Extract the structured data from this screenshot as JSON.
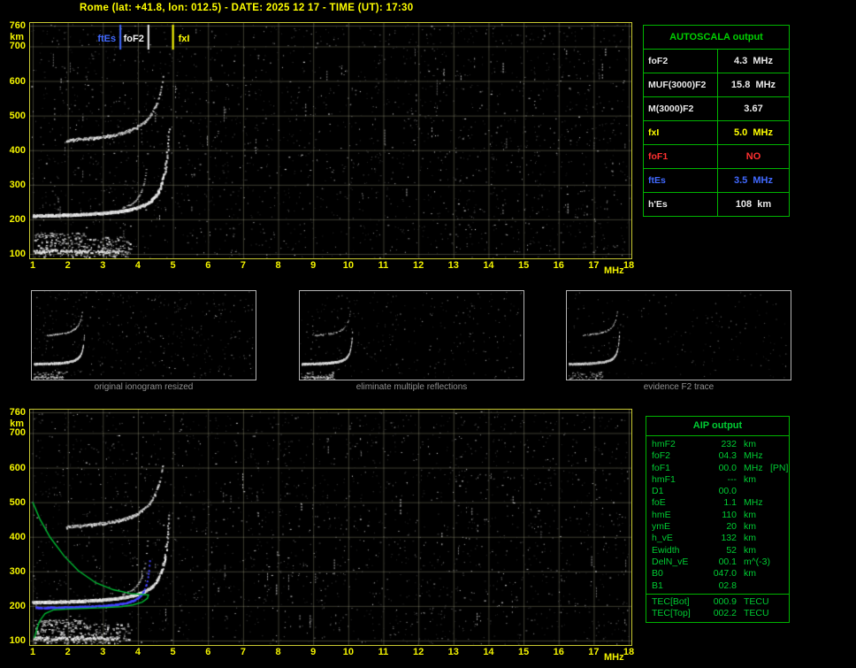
{
  "header": {
    "title": "Rome (lat: +41.8, lon: 012.5) - DATE: 2025 12 17 - TIME (UT): 17:30"
  },
  "axes": {
    "y_unit": "km",
    "x_unit": "MHz",
    "y_ticks": [
      760,
      700,
      600,
      500,
      400,
      300,
      200,
      100
    ],
    "x_ticks": [
      1,
      2,
      3,
      4,
      5,
      6,
      7,
      8,
      9,
      10,
      11,
      12,
      13,
      14,
      15,
      16,
      17,
      18
    ]
  },
  "top_plot": {
    "markers": [
      {
        "label": "ftEs",
        "freq": 3.5,
        "color": "#4169ff",
        "side": "left"
      },
      {
        "label": "foF2",
        "freq": 4.3,
        "color": "#f0f0f0",
        "side": "left"
      },
      {
        "label": "fxI",
        "freq": 5.0,
        "color": "#ffff00",
        "side": "right"
      }
    ]
  },
  "autoscala": {
    "title": "AUTOSCALA output",
    "rows": [
      {
        "param": "foF2",
        "value": "4.3",
        "unit": "MHz",
        "color": "#e8e8e8"
      },
      {
        "param": "MUF(3000)F2",
        "value": "15.8",
        "unit": "MHz",
        "color": "#e8e8e8"
      },
      {
        "param": "M(3000)F2",
        "value": "3.67",
        "unit": "",
        "color": "#e8e8e8"
      },
      {
        "param": "fxI",
        "value": "5.0",
        "unit": "MHz",
        "color": "#ffff00"
      },
      {
        "param": "foF1",
        "value": "NO",
        "unit": "",
        "color": "#ff3030"
      },
      {
        "param": "ftEs",
        "value": "3.5",
        "unit": "MHz",
        "color": "#4169ff"
      },
      {
        "param": "h'Es",
        "value": "108",
        "unit": "km",
        "color": "#e8e8e8"
      }
    ]
  },
  "thumbnails": [
    {
      "caption": "original ionogram resized"
    },
    {
      "caption": "eliminate multiple reflections"
    },
    {
      "caption": "evidence F2 trace"
    }
  ],
  "aip": {
    "title": "AIP output",
    "rows": [
      {
        "param": "hmF2",
        "value": "232",
        "unit": "km",
        "extra": ""
      },
      {
        "param": "foF2",
        "value": "04.3",
        "unit": "MHz",
        "extra": ""
      },
      {
        "param": "foF1",
        "value": "00.0",
        "unit": "MHz",
        "extra": "[PN]"
      },
      {
        "param": "hmF1",
        "value": "---",
        "unit": "km",
        "extra": ""
      },
      {
        "param": "D1",
        "value": "00.0",
        "unit": "",
        "extra": ""
      },
      {
        "param": "foE",
        "value": "1.1",
        "unit": "MHz",
        "extra": ""
      },
      {
        "param": "hmE",
        "value": "110",
        "unit": "km",
        "extra": ""
      },
      {
        "param": "ymE",
        "value": "20",
        "unit": "km",
        "extra": ""
      },
      {
        "param": "h_vE",
        "value": "132",
        "unit": "km",
        "extra": ""
      },
      {
        "param": "Ewidth",
        "value": "52",
        "unit": "km",
        "extra": ""
      },
      {
        "param": "DelN_vE",
        "value": "00.1",
        "unit": "m^(-3)",
        "extra": ""
      },
      {
        "param": "B0",
        "value": "047.0",
        "unit": "km",
        "extra": ""
      },
      {
        "param": "B1",
        "value": "02.8",
        "unit": "",
        "extra": ""
      }
    ],
    "tec_rows": [
      {
        "param": "TEC[Bot]",
        "value": "000.9",
        "unit": "TECU",
        "extra": ""
      },
      {
        "param": "TEC[Top]",
        "value": "002.2",
        "unit": "TECU",
        "extra": ""
      }
    ]
  },
  "colors": {
    "axis": "#f2f200",
    "plot_border": "#c8c832",
    "table_border": "#00b400",
    "aip_text": "#00cc33",
    "trace_blue": "#4444ff",
    "profile_green": "#00bb33",
    "red": "#ff3030",
    "yellow": "#ffff00"
  }
}
